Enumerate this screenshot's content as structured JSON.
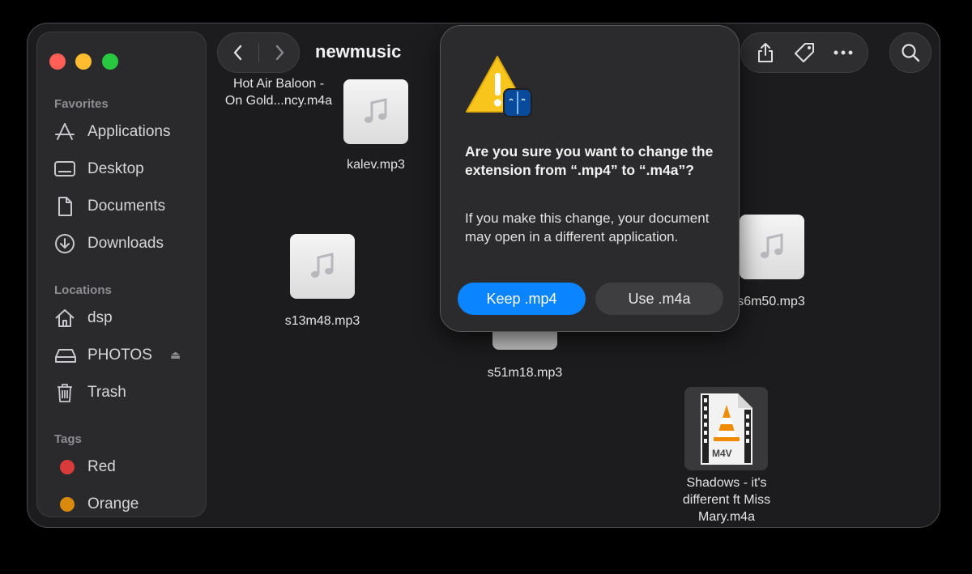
{
  "window": {
    "title": "newmusic"
  },
  "sidebar": {
    "favorites_title": "Favorites",
    "favorites": [
      {
        "label": "Applications",
        "icon": "applications-icon"
      },
      {
        "label": "Desktop",
        "icon": "desktop-icon"
      },
      {
        "label": "Documents",
        "icon": "document-icon"
      },
      {
        "label": "Downloads",
        "icon": "download-icon"
      }
    ],
    "locations_title": "Locations",
    "locations": [
      {
        "label": "dsp",
        "icon": "home-icon"
      },
      {
        "label": "PHOTOS",
        "icon": "drive-icon",
        "eject": "⏏"
      },
      {
        "label": "Trash",
        "icon": "trash-icon"
      }
    ],
    "tags_title": "Tags",
    "tags": [
      {
        "label": "Red",
        "color": "#d93a3a"
      },
      {
        "label": "Orange",
        "color": "#d98a0c"
      }
    ]
  },
  "files": [
    {
      "name_line1": "Hot Air Baloon -",
      "name_line2": "On Gold...ncy.m4a"
    },
    {
      "name": "kalev.mp3"
    },
    {
      "name": "s13m48.mp3"
    },
    {
      "name": "s51m18.mp3"
    },
    {
      "name": "s6m50.mp3"
    },
    {
      "name_line1": "Shadows - it's",
      "name_line2": "different ft Miss",
      "name_line3": "Mary.m4a",
      "badge": "M4V"
    }
  ],
  "dialog": {
    "title": "Are you sure you want to change the extension from “.mp4” to “.m4a”?",
    "body": "If you make this change, your document may open in a different application.",
    "keep_label": "Keep .mp4",
    "use_label": "Use .m4a"
  },
  "colors": {
    "accent": "#0a84ff"
  }
}
